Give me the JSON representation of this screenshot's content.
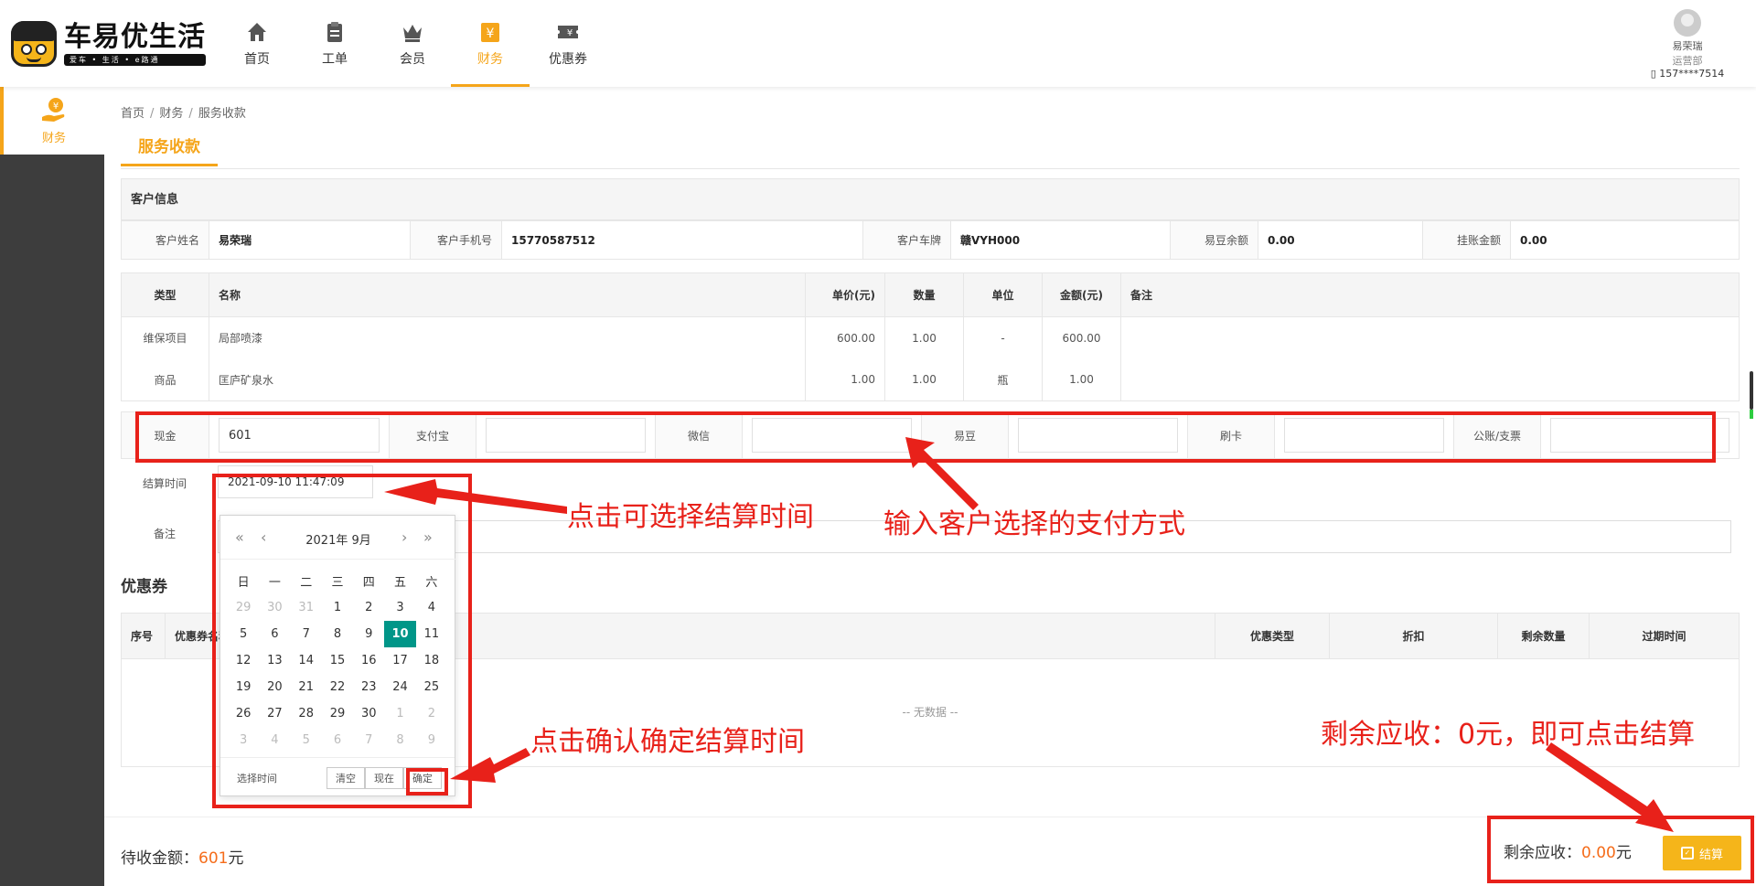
{
  "app": {
    "brand_name": "车易优生活",
    "brand_slogan": "爱车 • 生活 • e路通"
  },
  "nav": [
    {
      "label": "首页",
      "icon": "home-icon"
    },
    {
      "label": "工单",
      "icon": "clipboard-icon"
    },
    {
      "label": "会员",
      "icon": "crown-icon"
    },
    {
      "label": "财务",
      "icon": "finance-icon",
      "active": true
    },
    {
      "label": "优惠券",
      "icon": "coupon-icon"
    }
  ],
  "user": {
    "name": "易荣瑞",
    "dept": "运营部",
    "phone": "157****7514"
  },
  "sidebar": {
    "item_label": "财务"
  },
  "breadcrumb": [
    "首页",
    "财务",
    "服务收款"
  ],
  "page_title": "服务收款",
  "customer": {
    "section_title": "客户信息",
    "name_label": "客户姓名",
    "name": "易荣瑞",
    "phone_label": "客户手机号",
    "phone": "15770587512",
    "plate_label": "客户车牌",
    "plate": "赣VYH000",
    "balance_label": "易豆余额",
    "balance": "0.00",
    "credit_label": "挂账金额",
    "credit": "0.00"
  },
  "items": {
    "headers": [
      "类型",
      "名称",
      "单价(元)",
      "数量",
      "单位",
      "金额(元)",
      "备注"
    ],
    "rows": [
      {
        "type": "维保项目",
        "name": "局部喷漆",
        "price": "600.00",
        "qty": "1.00",
        "unit": "-",
        "amount": "600.00",
        "note": ""
      },
      {
        "type": "商品",
        "name": "匡庐矿泉水",
        "price": "1.00",
        "qty": "1.00",
        "unit": "瓶",
        "amount": "1.00",
        "note": ""
      }
    ]
  },
  "payment": {
    "cash_label": "现金",
    "cash_value": "601",
    "alipay_label": "支付宝",
    "wechat_label": "微信",
    "yidou_label": "易豆",
    "card_label": "刷卡",
    "corporate_label": "公账/支票"
  },
  "settle_time": {
    "label": "结算时间",
    "value": "2021-09-10 11:47:09"
  },
  "note": {
    "label": "备注"
  },
  "coupons": {
    "title": "优惠券",
    "headers": [
      "序号",
      "优惠券名称",
      "优惠类型",
      "折扣",
      "剩余数量",
      "过期时间"
    ],
    "empty_text": "-- 无数据 --"
  },
  "picker": {
    "year_month": "2021年  9月",
    "weekdays": [
      "日",
      "一",
      "二",
      "三",
      "四",
      "五",
      "六"
    ],
    "weeks": [
      [
        "29",
        "30",
        "31",
        "1",
        "2",
        "3",
        "4"
      ],
      [
        "5",
        "6",
        "7",
        "8",
        "9",
        "10",
        "11"
      ],
      [
        "12",
        "13",
        "14",
        "15",
        "16",
        "17",
        "18"
      ],
      [
        "19",
        "20",
        "21",
        "22",
        "23",
        "24",
        "25"
      ],
      [
        "26",
        "27",
        "28",
        "29",
        "30",
        "1",
        "2"
      ],
      [
        "3",
        "4",
        "5",
        "6",
        "7",
        "8",
        "9"
      ]
    ],
    "selected_day": "10",
    "select_time_label": "选择时间",
    "clear_label": "清空",
    "now_label": "现在",
    "confirm_label": "确定"
  },
  "footer": {
    "due_label": "待收金额：",
    "due_value": "601",
    "due_unit": "元",
    "remain_label": "剩余应收：",
    "remain_value": "0.00",
    "remain_unit": "元",
    "settle_button": "结算"
  },
  "annotations": {
    "time_hint": "点击可选择结算时间",
    "payment_hint": "输入客户选择的支付方式",
    "confirm_hint": "点击确认确定结算时间",
    "settle_hint": "剩余应收：0元，即可点击结算"
  },
  "colors": {
    "accent": "#f5a51a",
    "annotation": "#e8211a",
    "selected_day": "#009688",
    "amount": "#f56c1a"
  }
}
